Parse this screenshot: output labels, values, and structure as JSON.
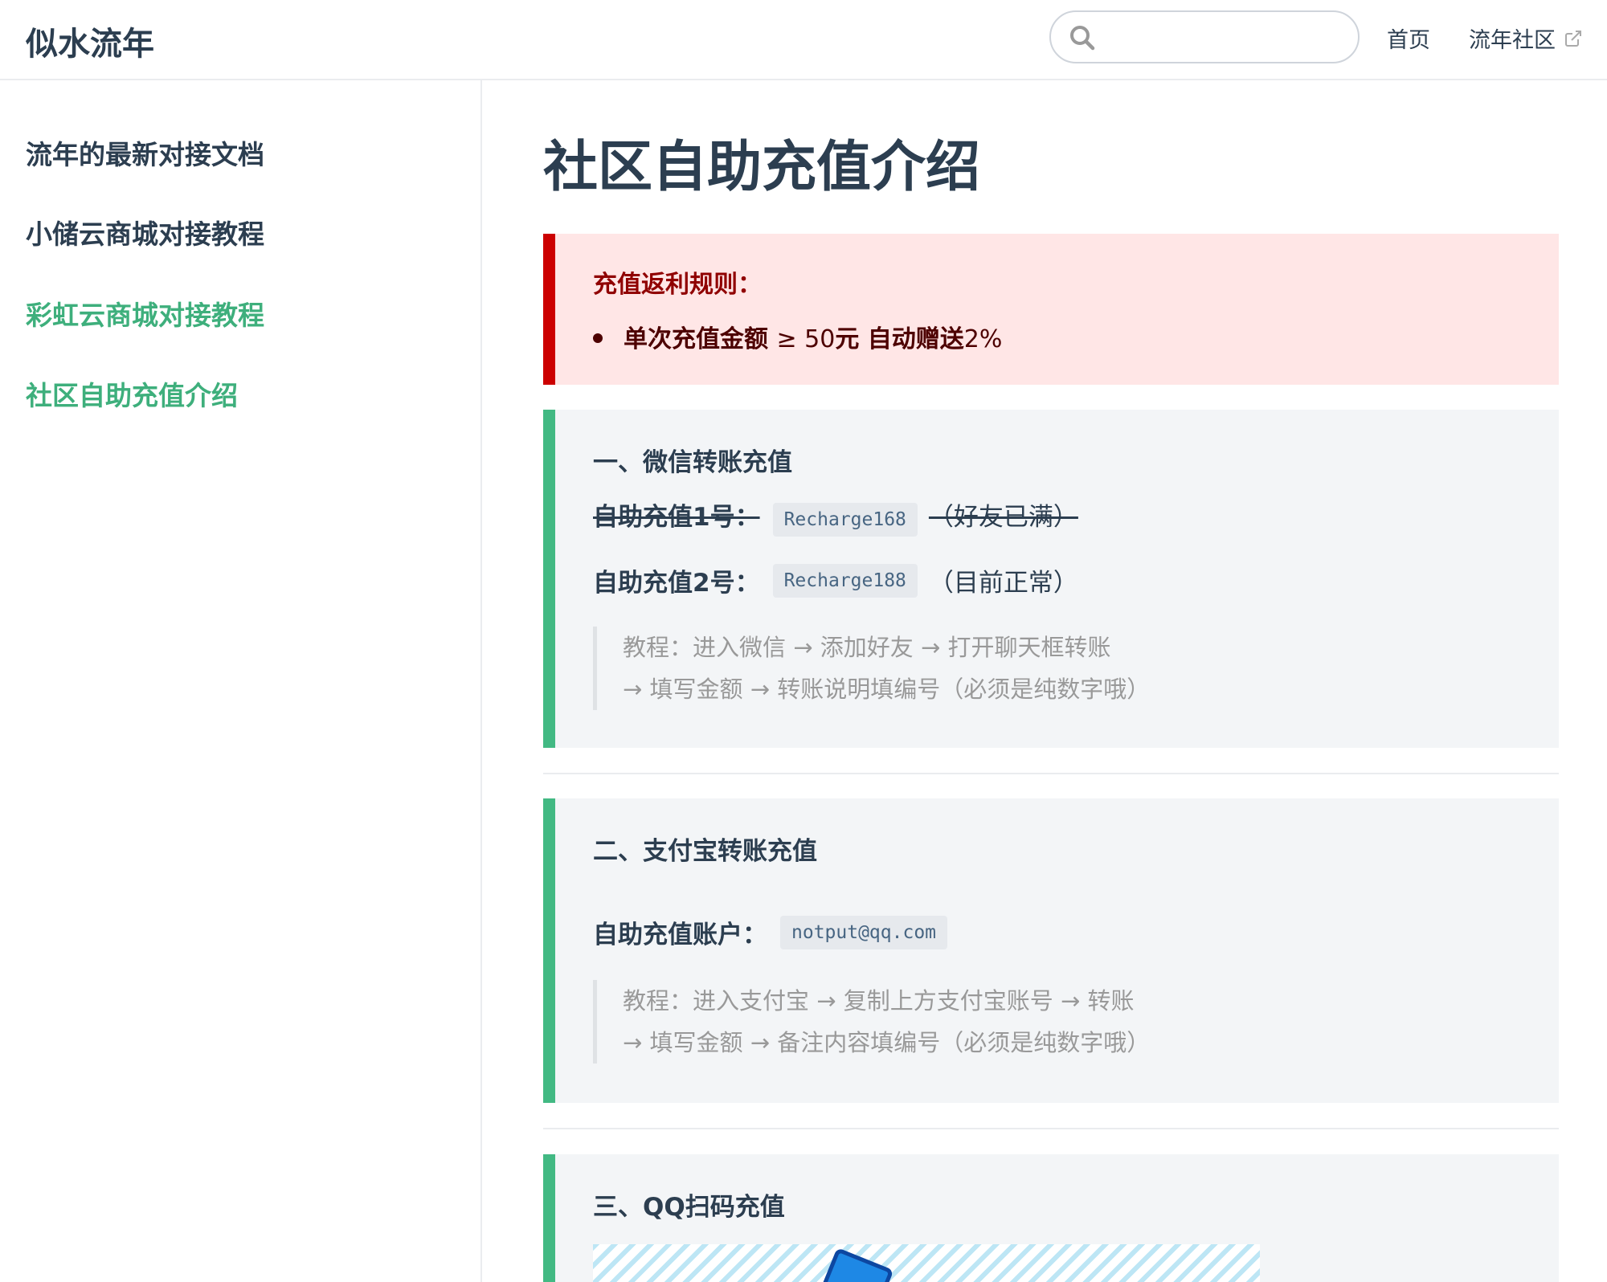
{
  "header": {
    "site_name": "似水流年",
    "search_placeholder": "",
    "nav": {
      "home": "首页",
      "community": "流年社区"
    }
  },
  "sidebar": {
    "items": [
      {
        "label": "流年的最新对接文档",
        "active": false
      },
      {
        "label": "小储云商城对接教程",
        "active": false
      },
      {
        "label": "彩虹云商城对接教程",
        "active": true
      },
      {
        "label": "社区自助充值介绍",
        "active": true
      }
    ]
  },
  "main": {
    "title": "社区自助充值介绍",
    "danger": {
      "title": "充值返利规则：",
      "item_prefix": "单次充值金额",
      "item_symbol": "≥ 50",
      "item_unit": "元 自动赠送",
      "item_rate": "2%"
    },
    "wechat": {
      "title": "一、微信转账充值",
      "line1_label": "自助充值1号：",
      "line1_code": "Recharge168",
      "line1_note": "（好友已满）",
      "line2_label": "自助充值2号：",
      "line2_code": "Recharge188",
      "line2_note": "（目前正常）",
      "quote_line1": "教程：进入微信 → 添加好友 → 打开聊天框转账",
      "quote_line2": "→ 填写金额 → 转账说明填编号（必须是纯数字哦）"
    },
    "alipay": {
      "title": "二、支付宝转账充值",
      "account_label": "自助充值账户：",
      "account_code": "notput@qq.com",
      "quote_line1": "教程：进入支付宝 → 复制上方支付宝账号 → 转账",
      "quote_line2": "→ 填写金额 → 备注内容填编号（必须是纯数字哦）"
    },
    "qq": {
      "title": "三、QQ扫码充值"
    }
  },
  "colors": {
    "accent": "#3eaf7c",
    "danger_border": "#cc0000",
    "danger_bg": "#ffe6e6",
    "tip_border": "#42b983",
    "tip_bg": "#f3f5f7"
  },
  "icons": {
    "search": "search-icon",
    "external_link": "external-link-icon"
  }
}
